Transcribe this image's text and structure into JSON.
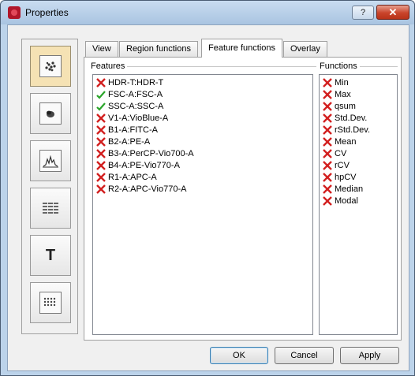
{
  "window": {
    "title": "Properties",
    "help_glyph": "?",
    "close_glyph": "✕"
  },
  "toolbar": {
    "buttons": [
      {
        "name": "dot-plot-icon",
        "active": true
      },
      {
        "name": "density-plot-icon",
        "active": false
      },
      {
        "name": "histogram-icon",
        "active": false
      },
      {
        "name": "table-icon",
        "active": false
      },
      {
        "name": "text-icon",
        "label": "T",
        "active": false
      },
      {
        "name": "grid-icon",
        "active": false
      }
    ]
  },
  "tabs": [
    {
      "label": "View",
      "active": false
    },
    {
      "label": "Region functions",
      "active": false
    },
    {
      "label": "Feature functions",
      "active": true
    },
    {
      "label": "Overlay",
      "active": false
    }
  ],
  "features": {
    "label": "Features",
    "items": [
      {
        "label": "HDR-T:HDR-T",
        "checked": false
      },
      {
        "label": "FSC-A:FSC-A",
        "checked": true
      },
      {
        "label": "SSC-A:SSC-A",
        "checked": true
      },
      {
        "label": "V1-A:VioBlue-A",
        "checked": false
      },
      {
        "label": "B1-A:FITC-A",
        "checked": false
      },
      {
        "label": "B2-A:PE-A",
        "checked": false
      },
      {
        "label": "B3-A:PerCP-Vio700-A",
        "checked": false
      },
      {
        "label": "B4-A:PE-Vio770-A",
        "checked": false
      },
      {
        "label": "R1-A:APC-A",
        "checked": false
      },
      {
        "label": "R2-A:APC-Vio770-A",
        "checked": false
      }
    ]
  },
  "functions": {
    "label": "Functions",
    "items": [
      {
        "label": "Min",
        "checked": false
      },
      {
        "label": "Max",
        "checked": false
      },
      {
        "label": "qsum",
        "checked": false
      },
      {
        "label": "Std.Dev.",
        "checked": false
      },
      {
        "label": "rStd.Dev.",
        "checked": false
      },
      {
        "label": "Mean",
        "checked": false
      },
      {
        "label": "CV",
        "checked": false
      },
      {
        "label": "rCV",
        "checked": false
      },
      {
        "label": "hpCV",
        "checked": false
      },
      {
        "label": "Median",
        "checked": false
      },
      {
        "label": "Modal",
        "checked": false
      }
    ]
  },
  "buttons": {
    "ok": "OK",
    "cancel": "Cancel",
    "apply": "Apply"
  },
  "colors": {
    "cross": "#d21f1f",
    "check": "#2aa52a",
    "active_tool": "#f5e2b4"
  }
}
